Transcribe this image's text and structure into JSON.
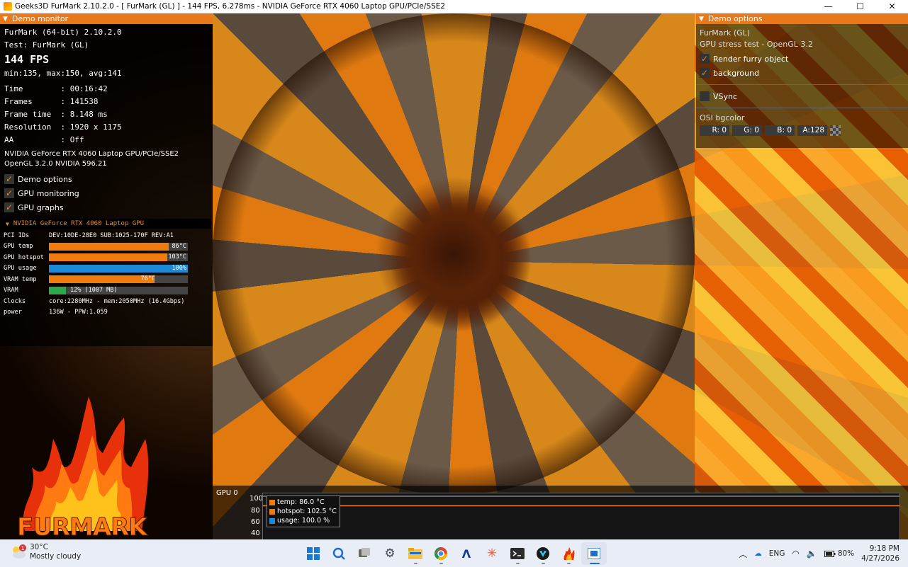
{
  "window": {
    "title": "Geeks3D FurMark 2.10.2.0 - [ FurMark (GL) ] - 144 FPS, 6.278ms - NVIDIA GeForce RTX 4060 Laptop GPU/PCIe/SSE2",
    "minimize": "—",
    "maximize": "☐",
    "close": "✕"
  },
  "demo_monitor": {
    "header": "Demo monitor",
    "app": "FurMark (64-bit) 2.10.2.0",
    "test": "Test: FurMark (GL)",
    "fps": "144 FPS",
    "fps_stats": "min:135, max:150, avg:141",
    "time": "Time        : 00:16:42",
    "frames": "Frames      : 141538",
    "frame_time": "Frame time  : 8.148 ms",
    "resolution": "Resolution  : 1920 x 1175",
    "aa": "AA          : Off",
    "gpu_name": "NVIDIA GeForce RTX 4060 Laptop GPU/PCIe/SSE2",
    "gl_version": "OpenGL 3.2.0 NVIDIA 596.21",
    "checkboxes": [
      {
        "label": "Demo options",
        "checked": true
      },
      {
        "label": "GPU monitoring",
        "checked": true
      },
      {
        "label": "GPU graphs",
        "checked": true
      }
    ]
  },
  "gpu_monitor": {
    "header": "NVIDIA GeForce RTX 4060 Laptop GPU",
    "pci_label": "PCI IDs",
    "pci_value": "DEV:10DE-28E0 SUB:1025-170F REV:A1",
    "temp_label": "GPU temp",
    "temp_value": "86°C",
    "temp_fraction": 0.86,
    "hotspot_label": "GPU hotspot",
    "hotspot_value": "103°C",
    "hotspot_fraction": 0.85,
    "usage_label": "GPU usage",
    "usage_value": "100%",
    "usage_fraction": 1.0,
    "vram_temp_label": "VRAM temp",
    "vram_temp_value": "76°C",
    "vram_temp_fraction": 0.76,
    "vram_label": "VRAM",
    "vram_value": "12% (1007 MB)",
    "vram_fraction": 0.12,
    "clocks_label": "Clocks",
    "clocks_value": "core:2280MHz - mem:2050MHz (16.4Gbps)",
    "power_label": "power",
    "power_value": "136W - PPW:1.059",
    "colors": {
      "temp": "#f07c10",
      "usage": "#1c8ad6",
      "vram": "#2ea84a"
    }
  },
  "logo": {
    "text": "FURMARK"
  },
  "demo_options": {
    "header": "Demo options",
    "name": "FurMark (GL)",
    "description": "GPU stress test - OpenGL 3.2",
    "checkboxes": [
      {
        "label": "Render furry object",
        "checked": true
      },
      {
        "label": "background",
        "checked": true
      },
      {
        "label": "VSync",
        "checked": false
      }
    ],
    "osi_label": "OSI bgcolor",
    "r": "R: 0",
    "g": "G: 0",
    "b": "B: 0",
    "a": "A:128"
  },
  "graph": {
    "title": "GPU 0",
    "yticks": [
      "100",
      "80",
      "60",
      "40"
    ],
    "legend": [
      {
        "label": "temp: 86.0 °C",
        "color": "#f07c10"
      },
      {
        "label": "hotspot: 102.5 °C",
        "color": "#f07c10"
      },
      {
        "label": "usage: 100.0 %",
        "color": "#1c8ad6"
      }
    ],
    "series": {
      "temp": 86.0,
      "hotspot": 102.5,
      "usage": 100.0
    },
    "ylim": [
      40,
      100
    ]
  },
  "taskbar": {
    "weather_temp": "30°C",
    "weather_desc": "Mostly cloudy",
    "weather_badge": "1",
    "apps": [
      "windows-start",
      "search",
      "task-view",
      "settings",
      "file-explorer",
      "chrome",
      "app-a",
      "app-star",
      "terminal",
      "predator",
      "furmark",
      "active-app"
    ],
    "language": "ENG",
    "battery": "80%",
    "time": "9:18 PM",
    "date": "4/27/2026"
  }
}
